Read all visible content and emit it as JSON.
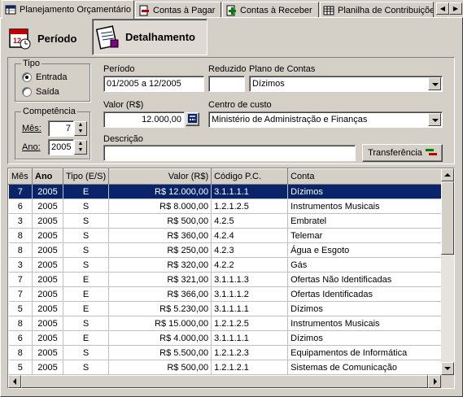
{
  "tabs": [
    {
      "label": "Planejamento Orçamentário",
      "icon": "spreadsheet-icon",
      "active": true
    },
    {
      "label": "Contas à Pagar",
      "icon": "payable-icon",
      "active": false
    },
    {
      "label": "Contas à Receber",
      "icon": "receivable-icon",
      "active": false
    },
    {
      "label": "Planilha de Contribuições",
      "icon": "grid-sheet-icon",
      "active": false
    }
  ],
  "modes": {
    "periodo_label": "Período",
    "detalhamento_label": "Detalhamento"
  },
  "form": {
    "tipo": {
      "legend": "Tipo",
      "options": [
        "Entrada",
        "Saída"
      ],
      "selected": "Entrada"
    },
    "competencia": {
      "legend": "Competência",
      "mes_label": "Mês:",
      "mes_value": "7",
      "ano_label": "Ano:",
      "ano_value": "2005"
    },
    "periodo": {
      "label": "Período",
      "value": "01/2005 a 12/2005"
    },
    "reduzido": {
      "label": "Reduzido",
      "value": ""
    },
    "plano_contas": {
      "label": "Plano de Contas",
      "value": "Dízimos"
    },
    "valor": {
      "label": "Valor (R$)",
      "value": "12.000,00"
    },
    "centro_custo": {
      "label": "Centro de custo",
      "value": "Ministério de Administração e Finanças"
    },
    "descricao": {
      "label": "Descrição",
      "value": ""
    },
    "transferencia_label": "Transferência"
  },
  "table": {
    "columns": [
      "Mês",
      "Ano",
      "Tipo (E/S)",
      "Valor (R$)",
      "Código P.C.",
      "Conta"
    ],
    "rows": [
      [
        "7",
        "2005",
        "E",
        "R$ 12.000,00",
        "3.1.1.1.1",
        "Dízimos"
      ],
      [
        "6",
        "2005",
        "S",
        "R$ 8.000,00",
        "1.2.1.2.5",
        "Instrumentos Musicais"
      ],
      [
        "3",
        "2005",
        "S",
        "R$ 500,00",
        "4.2.5",
        "Embratel"
      ],
      [
        "8",
        "2005",
        "S",
        "R$ 360,00",
        "4.2.4",
        "Telemar"
      ],
      [
        "8",
        "2005",
        "S",
        "R$ 250,00",
        "4.2.3",
        "Água e Esgoto"
      ],
      [
        "3",
        "2005",
        "S",
        "R$ 320,00",
        "4.2.2",
        "Gás"
      ],
      [
        "7",
        "2005",
        "E",
        "R$ 321,00",
        "3.1.1.1.3",
        "Ofertas Não Identificadas"
      ],
      [
        "7",
        "2005",
        "E",
        "R$ 366,00",
        "3.1.1.1.2",
        "Ofertas Identificadas"
      ],
      [
        "5",
        "2005",
        "E",
        "R$ 5.230,00",
        "3.1.1.1.1",
        "Dízimos"
      ],
      [
        "8",
        "2005",
        "S",
        "R$ 15.000,00",
        "1.2.1.2.5",
        "Instrumentos Musicais"
      ],
      [
        "6",
        "2005",
        "E",
        "R$ 4.000,00",
        "3.1.1.1.1",
        "Dízimos"
      ],
      [
        "8",
        "2005",
        "S",
        "R$ 5.500,00",
        "1.2.1.2.3",
        "Equipamentos de Informática"
      ],
      [
        "5",
        "2005",
        "S",
        "R$ 500,00",
        "1.2.1.2.1",
        "Sistemas de Comunicação"
      ]
    ],
    "selected_row": 0
  },
  "colors": {
    "selection": "#0a246a",
    "face": "#d4d0c8"
  }
}
